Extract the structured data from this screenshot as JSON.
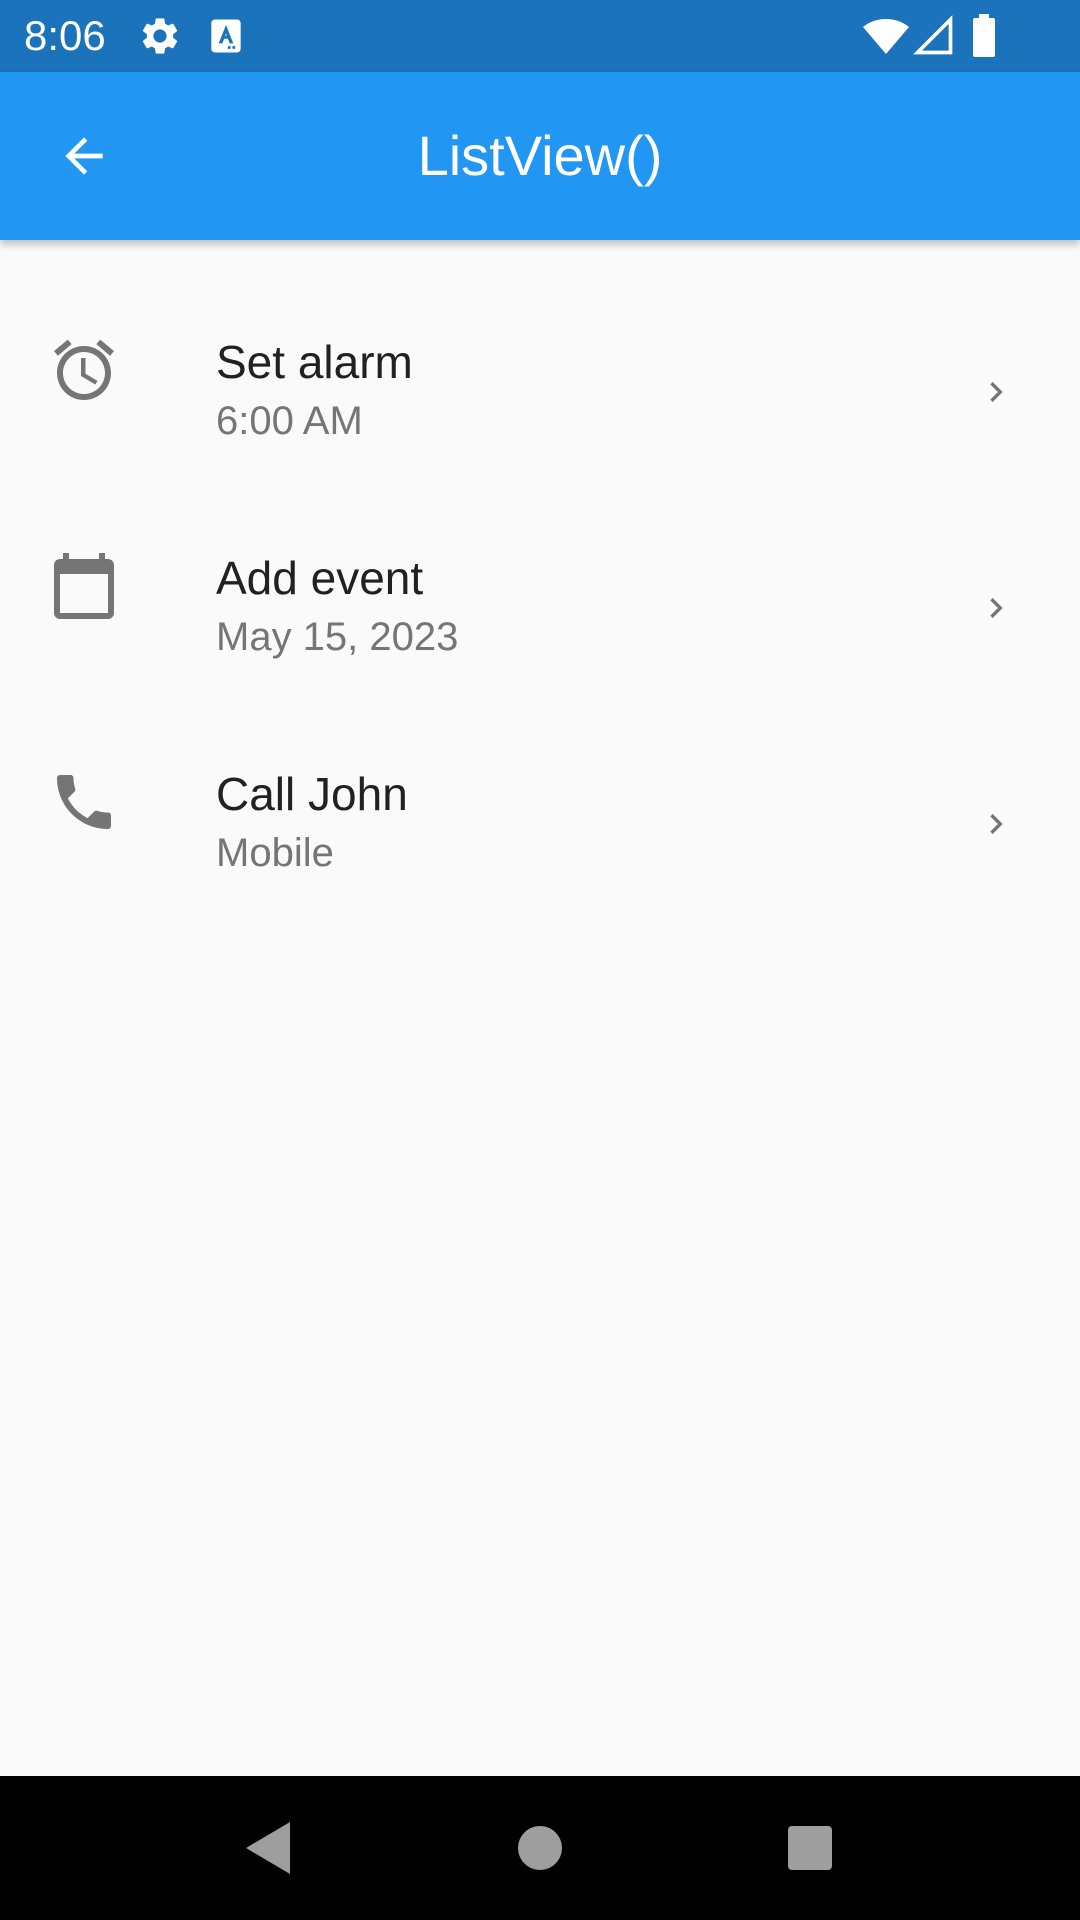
{
  "status_bar": {
    "time": "8:06",
    "icons": [
      "settings-icon",
      "keyboard-a-icon",
      "wifi-icon",
      "cellular-signal-icon",
      "battery-icon"
    ]
  },
  "app_bar": {
    "title": "ListView()",
    "back_icon": "arrow-back-icon",
    "background_color": "#2196f3"
  },
  "list": {
    "items": [
      {
        "title": "Set alarm",
        "subtitle": "6:00 AM",
        "icon": "alarm-icon"
      },
      {
        "title": "Add event",
        "subtitle": "May 15, 2023",
        "icon": "calendar-icon"
      },
      {
        "title": "Call John",
        "subtitle": "Mobile",
        "icon": "phone-icon"
      }
    ],
    "trailing_icon": "chevron-right-icon"
  },
  "nav_bar": {
    "buttons": [
      "back-triangle-icon",
      "home-circle-icon",
      "recents-square-icon"
    ]
  }
}
